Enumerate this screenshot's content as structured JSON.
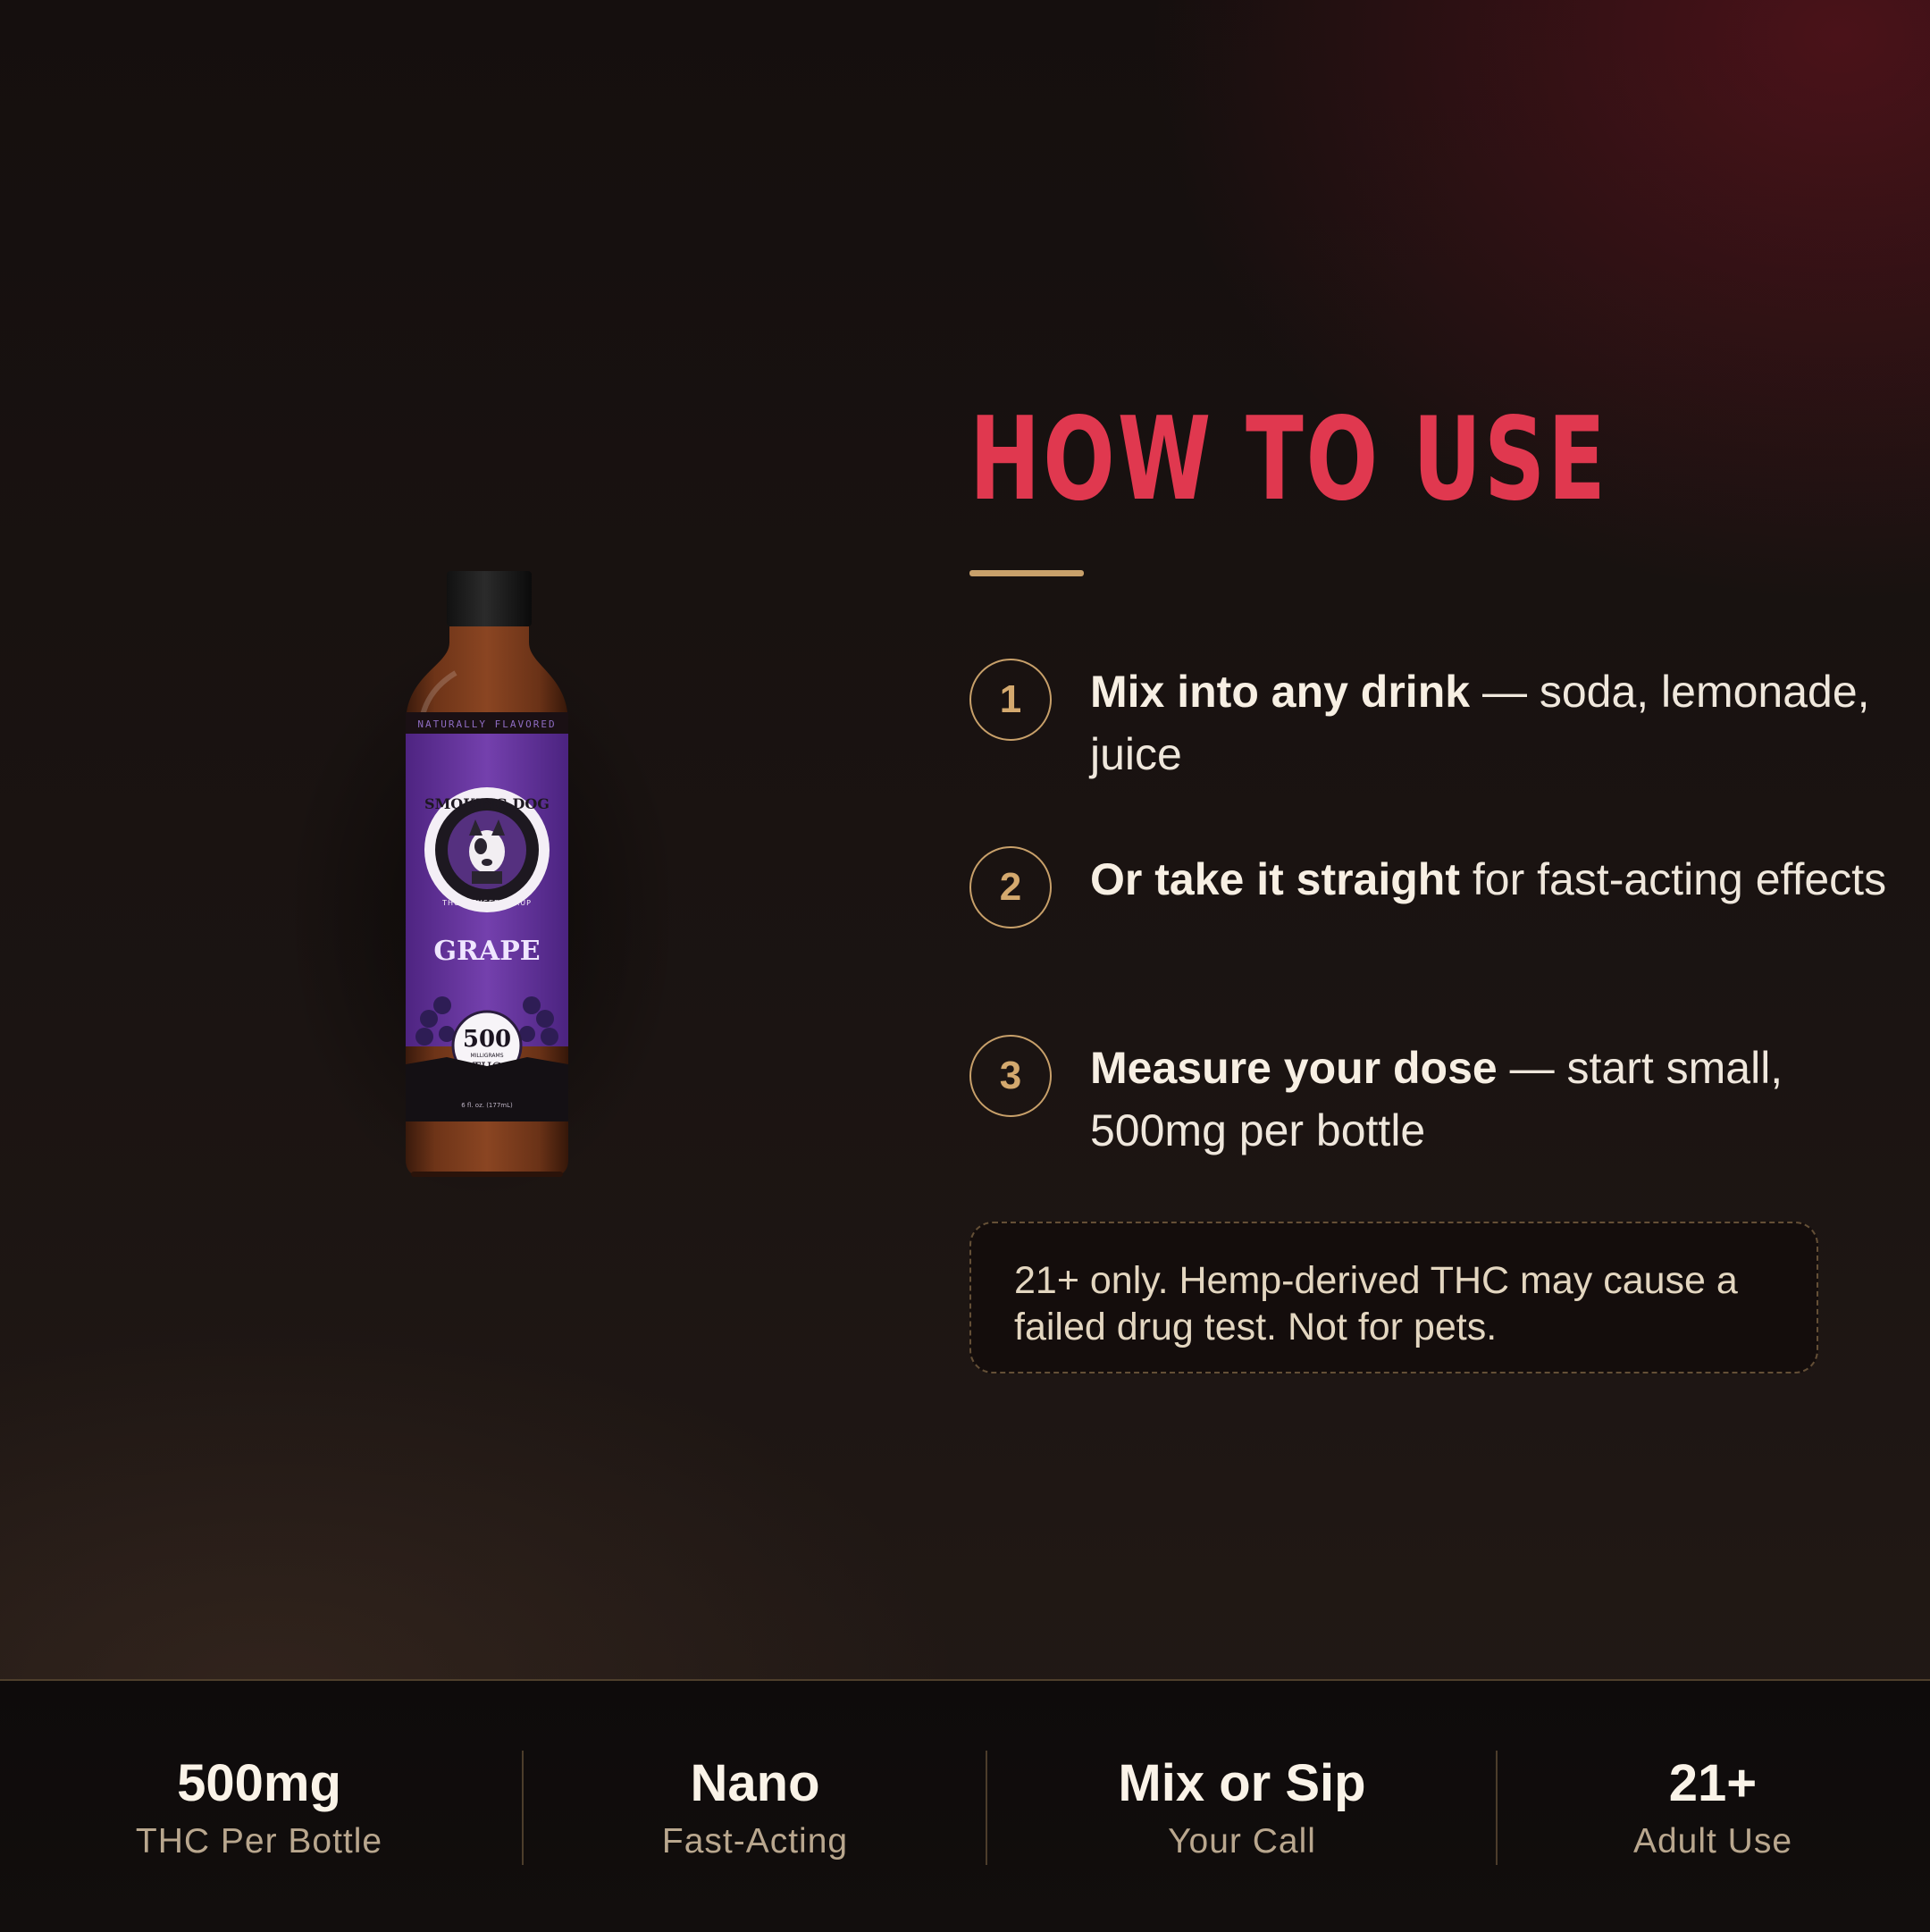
{
  "colors": {
    "accent_red": "#e0384f",
    "accent_gold": "#c8a06a",
    "label_purple": "#6e3aa3",
    "text_cream": "#efe7dc"
  },
  "product": {
    "label_top": "NATURALLY FLAVORED",
    "brand": "SMOKING DOG",
    "sub_brand": "THC INFUSED SYRUP",
    "flavor": "GRAPE",
    "dose_value": "500",
    "dose_unit": "MILLIGRAMS",
    "dose_type": "THC",
    "volume": "6 fl. oz. (177mL)"
  },
  "section": {
    "title": "HOW TO USE"
  },
  "steps": [
    {
      "number": "1",
      "bold": "Mix into any drink",
      "rest": " — soda, lemonade, juice"
    },
    {
      "number": "2",
      "bold": "Or take it straight",
      "rest": " for fast-acting effects"
    },
    {
      "number": "3",
      "bold": "Measure your dose",
      "rest": " — start small, 500mg per bottle"
    }
  ],
  "notice": "21+ only. Hemp-derived THC may cause a failed drug test. Not for pets.",
  "stats": [
    {
      "value": "500mg",
      "label": "THC Per Bottle"
    },
    {
      "value": "Nano",
      "label": "Fast-Acting"
    },
    {
      "value": "Mix or Sip",
      "label": "Your Call"
    },
    {
      "value": "21+",
      "label": "Adult Use"
    }
  ]
}
